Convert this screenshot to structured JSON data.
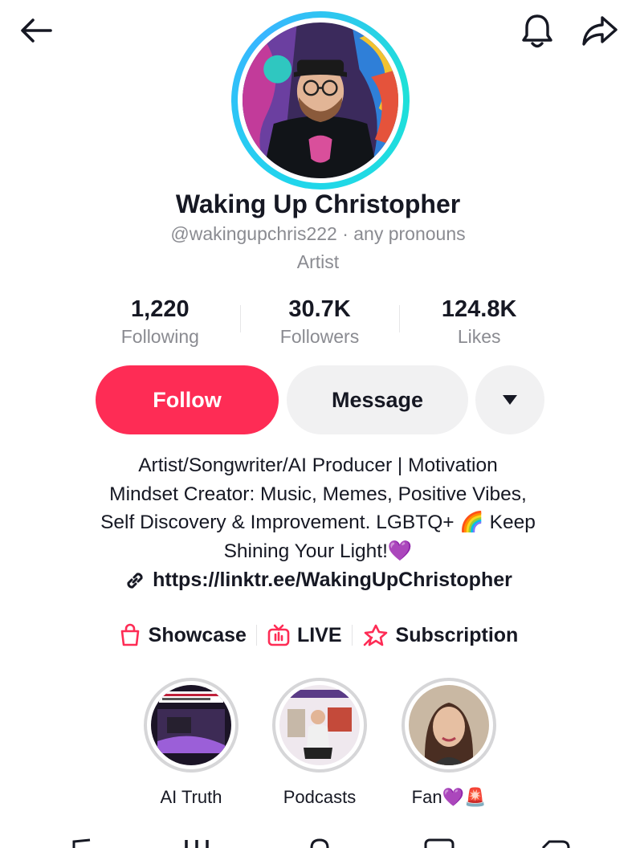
{
  "header": {
    "back_icon": "arrow-left-icon",
    "bell_icon": "bell-icon",
    "share_icon": "share-arrow-icon"
  },
  "profile": {
    "display_name": "Waking Up Christopher",
    "handle_line": "@wakingupchris222 · any pronouns",
    "category": "Artist",
    "ring_color": "#20d5ec"
  },
  "stats": [
    {
      "value": "1,220",
      "label": "Following"
    },
    {
      "value": "30.7K",
      "label": "Followers"
    },
    {
      "value": "124.8K",
      "label": "Likes"
    }
  ],
  "actions": {
    "follow_label": "Follow",
    "message_label": "Message",
    "more_icon": "caret-down-icon",
    "follow_color": "#fe2c55"
  },
  "bio": {
    "lines": [
      "Artist/Songwriter/AI Producer | Motivation",
      "Mindset Creator: Music, Memes, Positive Vibes,",
      "Self Discovery & Improvement. LGBTQ+ 🌈 Keep",
      "Shining Your Light!💜"
    ],
    "link": "https://linktr.ee/WakingUpChristopher",
    "link_icon": "link-icon"
  },
  "features": [
    {
      "label": "Showcase",
      "icon": "shopping-bag-icon"
    },
    {
      "label": "LIVE",
      "icon": "tv-live-icon"
    },
    {
      "label": "Subscription",
      "icon": "star-badge-icon"
    }
  ],
  "highlights": [
    {
      "label": "AI Truth"
    },
    {
      "label": "Podcasts"
    },
    {
      "label": "Fan💜🚨"
    }
  ]
}
